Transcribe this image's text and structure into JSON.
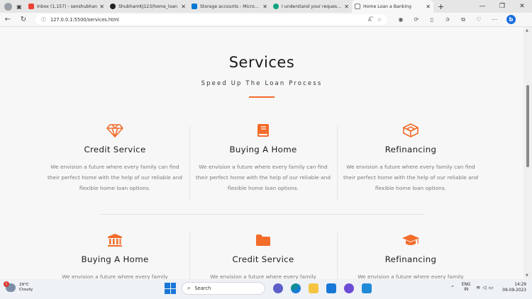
{
  "browser": {
    "tabs": [
      {
        "label": "Inbox (1,157) - senshubhan",
        "favicon_color": "#ea4335",
        "active": false
      },
      {
        "label": "ShubhamKJ123/home_loan",
        "favicon_color": "#202124",
        "active": false
      },
      {
        "label": "Storage accounts - Microsoft",
        "favicon_color": "#0078d4",
        "active": false
      },
      {
        "label": "I understand your request. I",
        "favicon_color": "#10a37f",
        "active": false
      },
      {
        "label": "Home Loan a Banking",
        "favicon_color": "#9e9e9e",
        "active": true
      }
    ],
    "new_tab": "+",
    "url": "127.0.0.1:5500/services.html",
    "win_minimize": "—",
    "win_restore": "❐",
    "win_close": "✕"
  },
  "page": {
    "title": "Services",
    "subtitle": "Speed Up The Loan Process",
    "accent_color": "#f26c2a",
    "cards": [
      {
        "icon": "diamond-icon",
        "title": "Credit Service",
        "desc": "We envision a future where every family can find their perfect home with the help of our reliable and flexible home loan options."
      },
      {
        "icon": "book-icon",
        "title": "Buying A Home",
        "desc": "We envision a future where every family can find their perfect home with the help of our reliable and flexible home loan options."
      },
      {
        "icon": "cube-icon",
        "title": "Refinancing",
        "desc": "We envision a future where every family can find their perfect home with the help of our reliable and flexible home loan options."
      },
      {
        "icon": "bank-icon",
        "title": "Buying A Home",
        "desc": "We envision a future where every family"
      },
      {
        "icon": "folder-icon",
        "title": "Credit Service",
        "desc": "We envision a future where every family"
      },
      {
        "icon": "graduation-cap-icon",
        "title": "Refinancing",
        "desc": "We envision a future where every family"
      }
    ]
  },
  "taskbar": {
    "weather_temp": "29°C",
    "weather_desc": "Cloudy",
    "weather_badge": "1",
    "search_placeholder": "Search",
    "lang_top": "ENG",
    "lang_bottom": "IN",
    "time": "14:29",
    "date": "09-09-2023"
  }
}
